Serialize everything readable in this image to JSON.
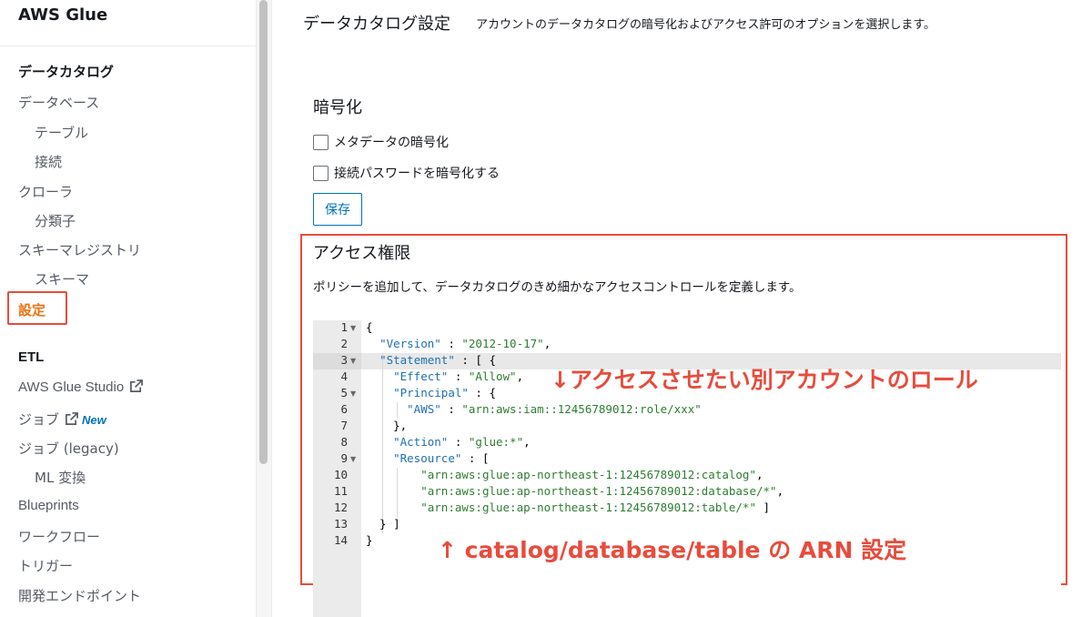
{
  "sidebar": {
    "brand": "AWS Glue",
    "data_catalog_heading": "データカタログ",
    "items": {
      "databases": "データベース",
      "tables": "テーブル",
      "connections": "接続",
      "crawlers": "クローラ",
      "classifiers": "分類子",
      "schema_registry": "スキーマレジストリ",
      "schemas": "スキーマ",
      "settings": "設定"
    },
    "etl_heading": "ETL",
    "etl_items": {
      "studio": "AWS Glue Studio",
      "jobs": "ジョブ",
      "jobs_new_badge": "New",
      "jobs_legacy": "ジョブ (legacy)",
      "ml_transforms": "ML 変換",
      "blueprints": "Blueprints",
      "workflows": "ワークフロー",
      "triggers": "トリガー",
      "dev_endpoints": "開発エンドポイント"
    }
  },
  "main": {
    "title": "データカタログ設定",
    "description": "アカウントのデータカタログの暗号化およびアクセス許可のオプションを選択します。",
    "encryption": {
      "title": "暗号化",
      "metadata_label": "メタデータの暗号化",
      "metadata_checked": false,
      "password_label": "接続パスワードを暗号化する",
      "password_checked": false,
      "save_label": "保存"
    },
    "access": {
      "title": "アクセス権限",
      "description": "ポリシーを追加して、データカタログのきめ細かなアクセスコントロールを定義します。"
    },
    "editor": {
      "line_numbers": [
        "1",
        "2",
        "3",
        "4",
        "5",
        "6",
        "7",
        "8",
        "9",
        "10",
        "11",
        "12",
        "13",
        "14"
      ],
      "active_line": 3
    },
    "policy": {
      "version": "\"2012-10-17\"",
      "effect": "\"Allow\"",
      "principal_aws": "\"arn:aws:iam::12456789012:role/xxx\"",
      "action": "\"glue:*\"",
      "resource_1": "\"arn:aws:glue:ap-northeast-1:12456789012:catalog\"",
      "resource_2": "\"arn:aws:glue:ap-northeast-1:12456789012:database/*\"",
      "resource_3": "\"arn:aws:glue:ap-northeast-1:12456789012:table/*\""
    },
    "annotations": {
      "role": "↓アクセスさせたい別アカウントのロール",
      "arn": "↑ catalog/database/table の ARN 設定"
    }
  },
  "colors": {
    "accent_orange": "#ec7211",
    "link_blue": "#0073bb",
    "annotation_red": "#e74c3c"
  }
}
